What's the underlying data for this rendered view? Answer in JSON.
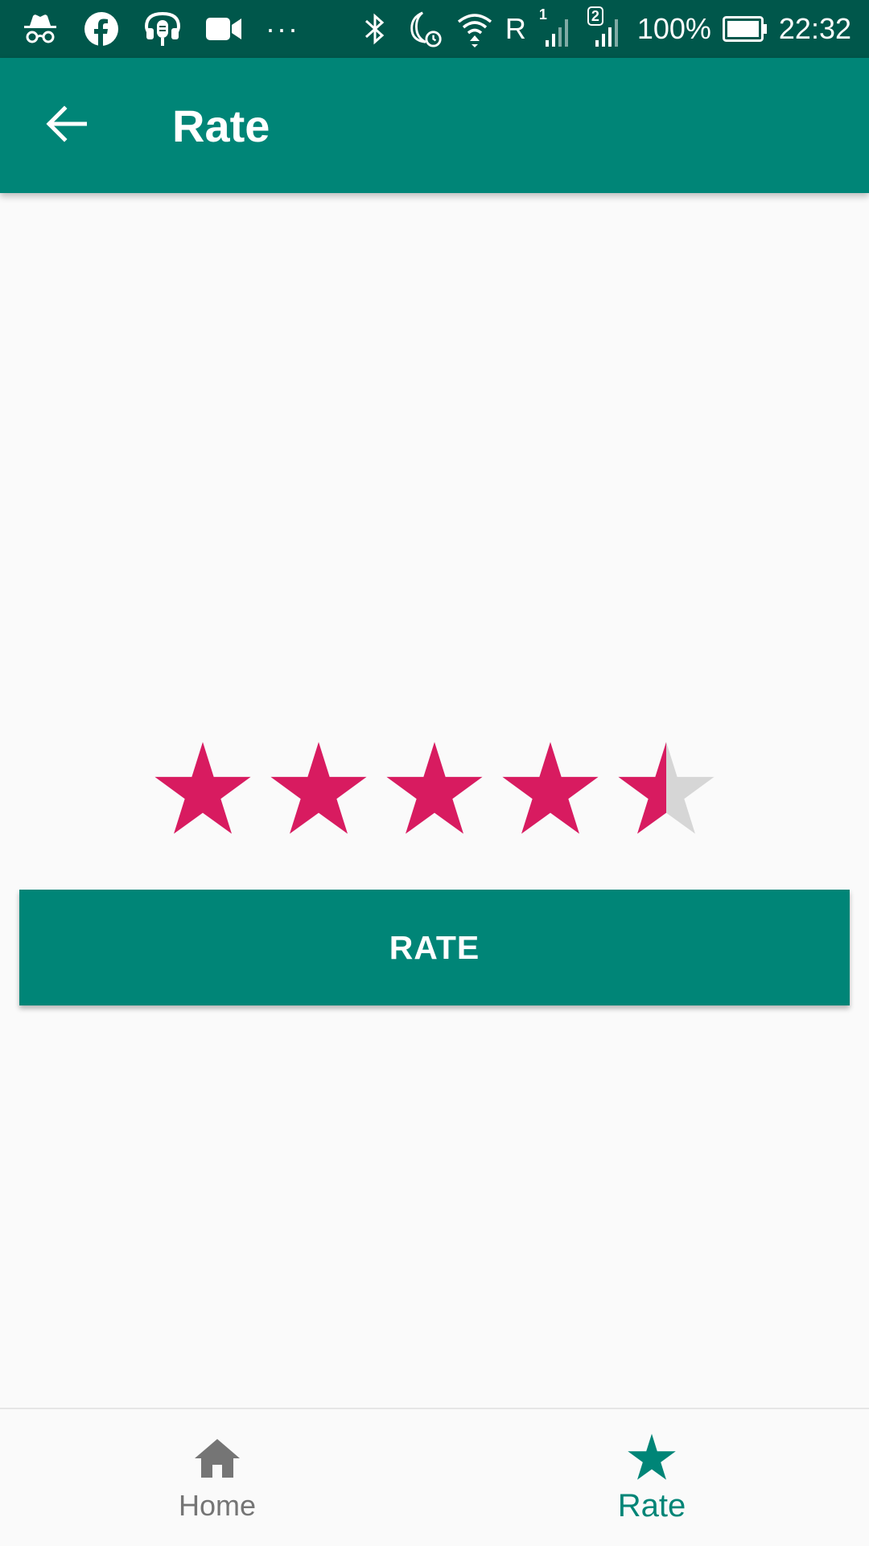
{
  "status_bar": {
    "icons": [
      "incognito-icon",
      "facebook-icon",
      "podcast-icon",
      "video-icon",
      "more-notifications-icon",
      "bluetooth-icon",
      "do-not-disturb-alarm-icon",
      "wifi-icon",
      "roaming-icon",
      "signal-sim1-icon",
      "signal-sim2-icon",
      "battery-icon"
    ],
    "roaming_label": "R",
    "sim1_label": "1",
    "sim2_label": "2",
    "battery_percent": "100%",
    "time": "22:32"
  },
  "app_bar": {
    "title": "Rate",
    "back_icon": "arrow-back-icon"
  },
  "rating": {
    "value": 4.5,
    "max": 5,
    "filled_color": "#d81b60",
    "empty_color": "#d6d6d6"
  },
  "rate_button": {
    "label": "RATE"
  },
  "bottom_nav": {
    "items": [
      {
        "label": "Home",
        "icon": "home-icon",
        "active": false
      },
      {
        "label": "Rate",
        "icon": "star-icon",
        "active": true
      }
    ]
  },
  "colors": {
    "primary": "#008577",
    "primary_dark": "#00574b",
    "accent": "#d81b60",
    "inactive": "#757575"
  }
}
